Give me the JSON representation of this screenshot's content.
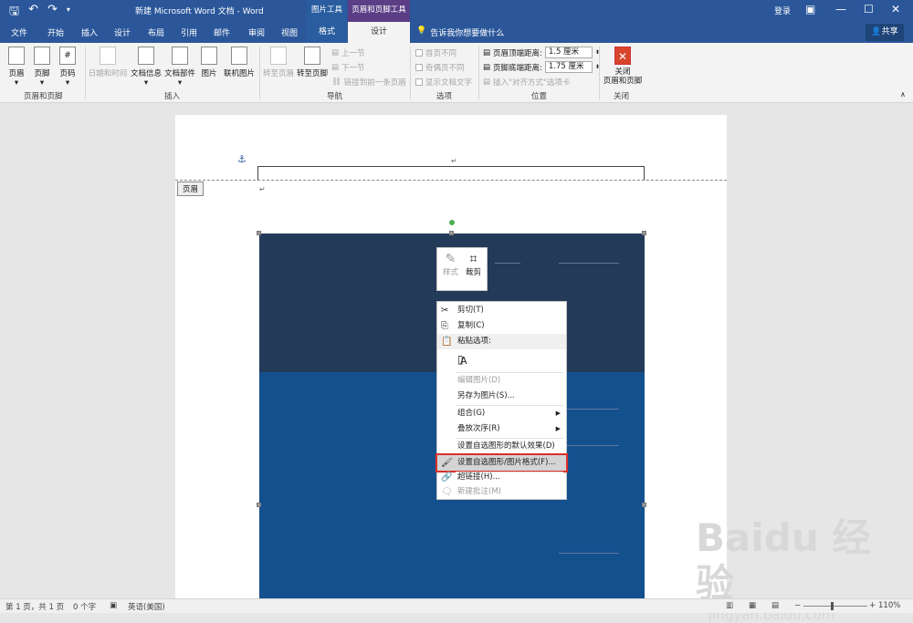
{
  "titlebar": {
    "title": "新建 Microsoft Word 文档 - Word",
    "ctx_picture_tools": "图片工具",
    "ctx_hf_tools": "页眉和页脚工具",
    "login": "登录"
  },
  "tabs": [
    "文件",
    "开始",
    "插入",
    "设计",
    "布局",
    "引用",
    "邮件",
    "审阅",
    "视图"
  ],
  "tab_format": "格式",
  "tab_design": "设计",
  "tellme": "告诉我你想要做什么",
  "share": "共享",
  "ribbon": {
    "header": "页眉",
    "footer": "页脚",
    "page_number": "页码",
    "group_hf": "页眉和页脚",
    "date_time": "日期和时间",
    "doc_info": "文档信息",
    "doc_parts": "文档部件",
    "picture": "图片",
    "online_picture": "联机图片",
    "group_insert": "插入",
    "goto_header": "转至页眉",
    "goto_footer": "转至页脚",
    "prev": "上一节",
    "next": "下一节",
    "link_prev": "链接到前一条页眉",
    "group_nav": "导航",
    "diff_first": "首页不同",
    "diff_odd_even": "奇偶页不同",
    "show_text": "显示文档文字",
    "group_options": "选项",
    "header_top_label": "页眉顶端距离:",
    "header_top_value": "1.5 厘米",
    "footer_bottom_label": "页脚底端距离:",
    "footer_bottom_value": "1.75 厘米",
    "insert_align_tab": "插入\"对齐方式\"选项卡",
    "group_position": "位置",
    "close_hf": "关闭\n页眉和页脚",
    "group_close": "关闭"
  },
  "doc": {
    "header_tag": "页眉",
    "para_mark": "↵"
  },
  "minibar": {
    "style": "样式",
    "crop": "裁剪"
  },
  "context_menu": [
    {
      "label": "剪切(T)",
      "icon": "cut-icon"
    },
    {
      "label": "复制(C)",
      "icon": "copy-icon"
    },
    {
      "label": "粘贴选项:",
      "icon": "paste-icon"
    },
    {
      "label": "A",
      "icon": "paste-picture-icon"
    },
    {
      "label": "编辑图片(D)",
      "icon": ""
    },
    {
      "label": "另存为图片(S)...",
      "icon": ""
    },
    {
      "label": "组合(G)",
      "icon": ""
    },
    {
      "label": "叠放次序(R)",
      "icon": ""
    },
    {
      "label": "设置自选图形的默认效果(D)",
      "icon": ""
    },
    {
      "label": "设置自选图形/图片格式(F)...",
      "icon": "format-picture-icon"
    },
    {
      "label": "超链接(H)...",
      "icon": "link-icon"
    },
    {
      "label": "新建批注(M)",
      "icon": "comment-icon"
    }
  ],
  "status": {
    "page": "第 1 页，共 1 页",
    "words": "0 个字",
    "lang": "英语(美国)",
    "zoom": "110%"
  },
  "watermark": {
    "brand": "Baidu 经验",
    "url": "jingyan.baidu.com"
  }
}
